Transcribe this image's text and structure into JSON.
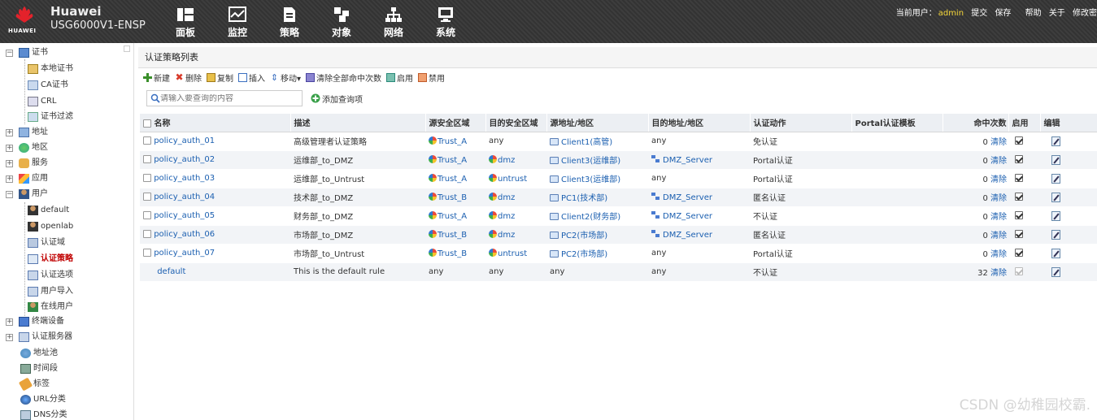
{
  "header": {
    "brand": "HUAWEI",
    "product_line1": "Huawei",
    "product_line2": "USG6000V1-ENSP",
    "nav": [
      {
        "label": "面板",
        "icon": "dashboard-icon"
      },
      {
        "label": "监控",
        "icon": "monitor-icon"
      },
      {
        "label": "策略",
        "icon": "policy-icon"
      },
      {
        "label": "对象",
        "icon": "object-icon"
      },
      {
        "label": "网络",
        "icon": "network-icon"
      },
      {
        "label": "系统",
        "icon": "system-icon"
      }
    ],
    "current_user_label": "当前用户：",
    "current_user": "admin",
    "links": [
      "提交",
      "保存",
      "帮助",
      "关于",
      "修改密"
    ]
  },
  "sidebar": {
    "items": [
      {
        "label": "证书",
        "toggle": "−",
        "level": 0
      },
      {
        "label": "本地证书",
        "level": 1
      },
      {
        "label": "CA证书",
        "level": 1
      },
      {
        "label": "CRL",
        "level": 1
      },
      {
        "label": "证书过滤",
        "level": 1
      },
      {
        "label": "地址",
        "toggle": "+",
        "level": 0
      },
      {
        "label": "地区",
        "toggle": "+",
        "level": 0
      },
      {
        "label": "服务",
        "toggle": "+",
        "level": 0
      },
      {
        "label": "应用",
        "toggle": "+",
        "level": 0
      },
      {
        "label": "用户",
        "toggle": "−",
        "level": 0
      },
      {
        "label": "default",
        "level": 1
      },
      {
        "label": "openlab",
        "level": 1
      },
      {
        "label": "认证域",
        "level": 1
      },
      {
        "label": "认证策略",
        "level": 1,
        "active": true
      },
      {
        "label": "认证选项",
        "level": 1
      },
      {
        "label": "用户导入",
        "level": 1
      },
      {
        "label": "在线用户",
        "level": 1
      },
      {
        "label": "终端设备",
        "toggle": "+",
        "level": 0
      },
      {
        "label": "认证服务器",
        "toggle": "+",
        "level": 0
      },
      {
        "label": "地址池",
        "level": 0
      },
      {
        "label": "时间段",
        "level": 0
      },
      {
        "label": "标签",
        "level": 0
      },
      {
        "label": "URL分类",
        "level": 0
      },
      {
        "label": "DNS分类",
        "level": 0
      }
    ]
  },
  "main": {
    "title": "认证策略列表",
    "toolbar": [
      {
        "label": "新建",
        "icon": "add-icon",
        "color": "#3a8f2a"
      },
      {
        "label": "删除",
        "icon": "delete-icon",
        "color": "#d83a2a"
      },
      {
        "label": "复制",
        "icon": "copy-icon",
        "color": "#d8a32a"
      },
      {
        "label": "插入",
        "icon": "insert-icon",
        "color": "#3a6fc0"
      },
      {
        "label": "移动▾",
        "icon": "move-icon",
        "color": "#3a6fc0"
      },
      {
        "label": "清除全部命中次数",
        "icon": "clear-hits-icon",
        "color": "#6a5fc0"
      },
      {
        "label": "启用",
        "icon": "enable-icon",
        "color": "#2a9a8a"
      },
      {
        "label": "禁用",
        "icon": "disable-icon",
        "color": "#d86a2a"
      }
    ],
    "search_placeholder": "请输入要查询的内容",
    "add_condition": "添加查询项",
    "columns": [
      "名称",
      "描述",
      "源安全区域",
      "目的安全区域",
      "源地址/地区",
      "目的地址/地区",
      "认证动作",
      "Portal认证模板",
      "命中次数",
      "启用",
      "编辑"
    ],
    "rows": [
      {
        "name": "policy_auth_01",
        "desc": "高级管理者认证策略",
        "src_zone": "Trust_A",
        "dst_zone": "any",
        "src_addr": "Client1(高管)",
        "dst_addr": "any",
        "action": "免认证",
        "portal": "",
        "hits": "0",
        "clear": "清除",
        "enabled": true
      },
      {
        "name": "policy_auth_02",
        "desc": "运维部_to_DMZ",
        "src_zone": "Trust_A",
        "dst_zone": "dmz",
        "src_addr": "Client3(运维部)",
        "dst_addr": "DMZ_Server",
        "action": "Portal认证",
        "portal": "",
        "hits": "0",
        "clear": "清除",
        "enabled": true
      },
      {
        "name": "policy_auth_03",
        "desc": "运维部_to_Untrust",
        "src_zone": "Trust_A",
        "dst_zone": "untrust",
        "src_addr": "Client3(运维部)",
        "dst_addr": "any",
        "action": "Portal认证",
        "portal": "",
        "hits": "0",
        "clear": "清除",
        "enabled": true
      },
      {
        "name": "policy_auth_04",
        "desc": "技术部_to_DMZ",
        "src_zone": "Trust_B",
        "dst_zone": "dmz",
        "src_addr": "PC1(技术部)",
        "dst_addr": "DMZ_Server",
        "action": "匿名认证",
        "portal": "",
        "hits": "0",
        "clear": "清除",
        "enabled": true
      },
      {
        "name": "policy_auth_05",
        "desc": "财务部_to_DMZ",
        "src_zone": "Trust_A",
        "dst_zone": "dmz",
        "src_addr": "Client2(财务部)",
        "dst_addr": "DMZ_Server",
        "action": "不认证",
        "portal": "",
        "hits": "0",
        "clear": "清除",
        "enabled": true
      },
      {
        "name": "policy_auth_06",
        "desc": "市场部_to_DMZ",
        "src_zone": "Trust_B",
        "dst_zone": "dmz",
        "src_addr": "PC2(市场部)",
        "dst_addr": "DMZ_Server",
        "action": "匿名认证",
        "portal": "",
        "hits": "0",
        "clear": "清除",
        "enabled": true
      },
      {
        "name": "policy_auth_07",
        "desc": "市场部_to_Untrust",
        "src_zone": "Trust_B",
        "dst_zone": "untrust",
        "src_addr": "PC2(市场部)",
        "dst_addr": "any",
        "action": "Portal认证",
        "portal": "",
        "hits": "0",
        "clear": "清除",
        "enabled": true
      },
      {
        "name": "default",
        "desc": "This is the default rule",
        "src_zone": "any",
        "dst_zone": "any",
        "src_addr": "any",
        "dst_addr": "any",
        "action": "不认证",
        "portal": "",
        "hits": "32",
        "clear": "清除",
        "enabled": true,
        "locked": true
      }
    ]
  },
  "watermark": "CSDN @幼稚园校霸.",
  "colors": {
    "header_bg": "#3a3a3a",
    "accent_red": "#c00000",
    "link": "#1b5fb0",
    "admin": "#f5d63a"
  }
}
